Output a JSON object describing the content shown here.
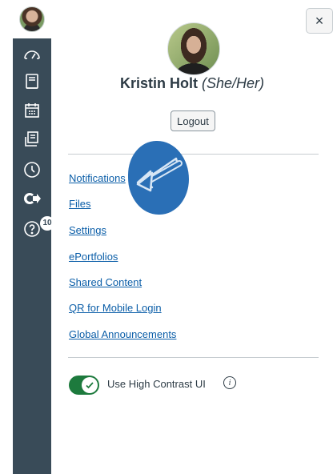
{
  "user": {
    "name": "Kristin Holt",
    "pronouns": "(She/Her)",
    "logout_label": "Logout"
  },
  "close": {
    "label": "×"
  },
  "links": [
    {
      "label": "Notifications"
    },
    {
      "label": "Files"
    },
    {
      "label": "Settings"
    },
    {
      "label": "ePortfolios"
    },
    {
      "label": "Shared Content"
    },
    {
      "label": "QR for Mobile Login"
    },
    {
      "label": "Global Announcements"
    }
  ],
  "toggle": {
    "label": "Use High Contrast UI",
    "on": true,
    "info": "i"
  },
  "rail": {
    "icons": [
      "account-avatar",
      "dashboard-icon",
      "courses-icon",
      "calendar-icon",
      "inbox-icon",
      "history-icon",
      "commons-icon",
      "help-icon"
    ],
    "help_badge": "10"
  },
  "colors": {
    "rail_bg": "#394b58",
    "link": "#0b5ea8",
    "toggle_on": "#1d7a3d",
    "annotation": "#2a6fb6"
  }
}
